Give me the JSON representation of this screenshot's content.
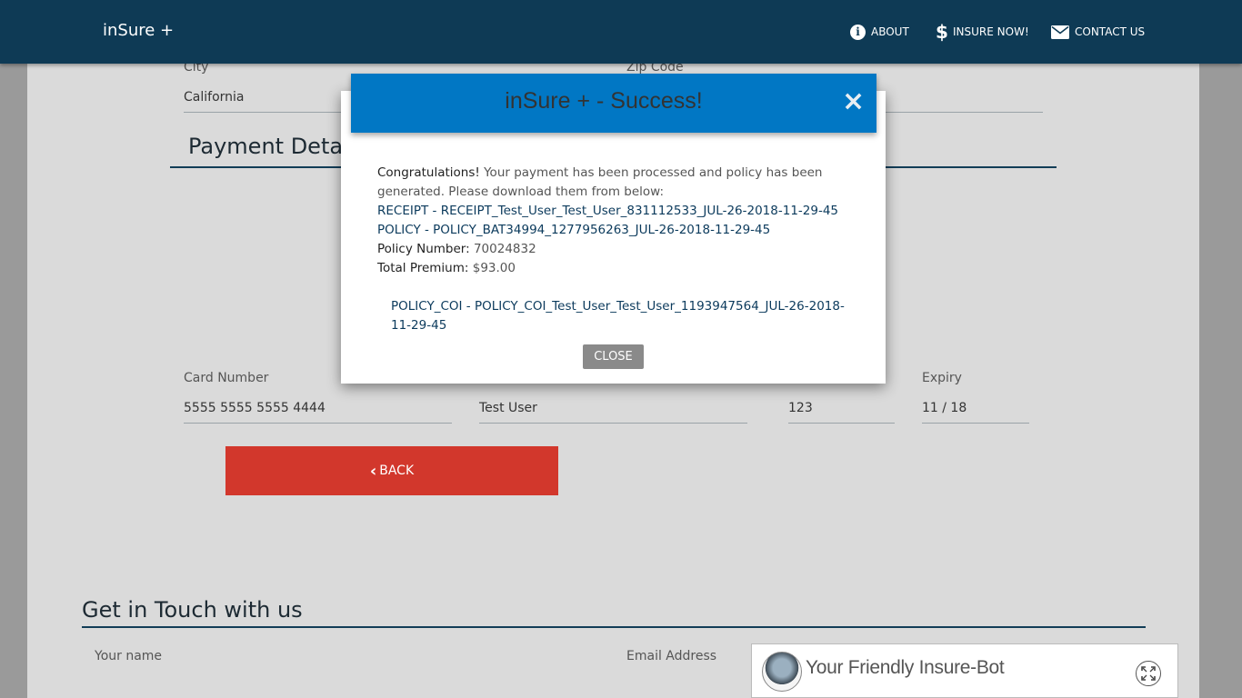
{
  "nav": {
    "brand": "inSure +",
    "items": [
      {
        "label": "ABOUT",
        "icon": "info-icon"
      },
      {
        "label": "INSURE NOW!",
        "icon": "dollar-icon"
      },
      {
        "label": "CONTACT US",
        "icon": "envelope-icon"
      }
    ]
  },
  "form": {
    "city_label": "City",
    "city_value": "California",
    "zip_label": "Zip Code",
    "payment_title": "Payment Detail",
    "card_number_label": "Card Number",
    "card_number_value": "5555 5555 5555 4444",
    "card_name_value": "Test User",
    "cvv_value": "123",
    "expiry_label": "Expiry",
    "expiry_value": "11 / 18",
    "back_label": "BACK"
  },
  "contact": {
    "title": "Get in Touch with us",
    "name_label": "Your name",
    "email_label": "Email Address"
  },
  "modal": {
    "title": "inSure + - Success!",
    "close_x": "×",
    "congrats": "Congratulations!",
    "message": " Your payment has been processed and policy has been generated. Please download them from below:",
    "receipt_link": "RECEIPT - RECEIPT_Test_User_Test_User_831112533_JUL-26-2018-11-29-45",
    "policy_link": "POLICY - POLICY_BAT34994_1277956263_JUL-26-2018-11-29-45",
    "policy_number_label": "Policy Number:",
    "policy_number_value": " 70024832",
    "total_premium_label": "Total Premium:",
    "total_premium_value": " $93.00",
    "coi_link": "POLICY_COI - POLICY_COI_Test_User_Test_User_1193947564_JUL-26-2018-11-29-45",
    "close_label": "CLOSE"
  },
  "chatbot": {
    "title": "Your Friendly Insure-Bot"
  },
  "colors": {
    "navbar": "#0e3a55",
    "modal_header": "#0177c4",
    "back_button": "#d2372c",
    "link": "#0b3a5c"
  }
}
